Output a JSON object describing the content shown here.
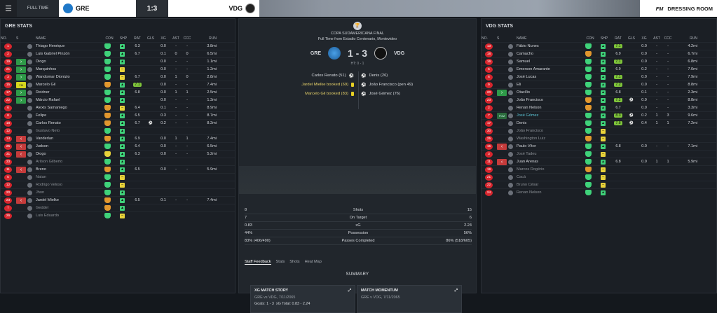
{
  "topbar": {
    "status": "FULL TIME",
    "home": "GRE",
    "score": "1:3",
    "away": "VDG",
    "brand": "FM",
    "section": "DRESSING ROOM"
  },
  "headers": [
    "NO.",
    "S",
    "NAME",
    "CON",
    "SHP",
    "RAT",
    "GLS",
    "XG",
    "AST",
    "CCC",
    "RUN"
  ],
  "colors": {
    "accent_red": "#d8262e",
    "sub_in": "#2e9a48",
    "sub_out": "#c53b3b",
    "best_rating": "#7ec43a"
  },
  "left": {
    "title": "GRE STATS",
    "rows": [
      {
        "no": "1",
        "sub": "",
        "name": "Thiago Henrique",
        "con": "g",
        "shp": "up",
        "rat": "6.3",
        "gls": "",
        "xg": "0.0",
        "ast": "-",
        "ccc": "-",
        "run": "3.8mi"
      },
      {
        "no": "2",
        "sub": "",
        "name": "Luis Gabriel Pinzón",
        "con": "g",
        "shp": "up",
        "rat": "6.7",
        "gls": "",
        "xg": "0.1",
        "ast": "0",
        "ccc": "0",
        "run": "6.5mi"
      },
      {
        "no": "19",
        "sub": "in",
        "name": "Diogo",
        "con": "g",
        "shp": "up",
        "rat": "",
        "gls": "",
        "xg": "0.0",
        "ast": "-",
        "ccc": "-",
        "run": "1.1mi"
      },
      {
        "no": "21",
        "sub": "in",
        "name": "Marquinhos",
        "con": "g",
        "shp": "mid",
        "rat": "",
        "gls": "",
        "xg": "0.0",
        "ast": "-",
        "ccc": "-",
        "run": "1.2mi"
      },
      {
        "no": "3",
        "sub": "in",
        "name": "Wandomar Dionizio",
        "con": "g",
        "shp": "mid",
        "rat": "6.7",
        "gls": "",
        "xg": "0.0",
        "ast": "1",
        "ccc": "0",
        "run": "2.8mi"
      },
      {
        "no": "15",
        "sub": "y",
        "name": "Marcelo Gil",
        "con": "o",
        "shp": "up",
        "rat": "7.1",
        "best": true,
        "gls": "",
        "xg": "0.0",
        "ast": "-",
        "ccc": "-",
        "run": "7.4mi"
      },
      {
        "no": "17",
        "sub": "in",
        "name": "Reidner",
        "con": "g",
        "shp": "up",
        "rat": "6.8",
        "gls": "",
        "xg": "0.0",
        "ast": "1",
        "ccc": "1",
        "run": "2.5mi"
      },
      {
        "no": "22",
        "sub": "in",
        "name": "Márcio Rafael",
        "con": "g",
        "shp": "up",
        "rat": "",
        "gls": "",
        "xg": "0.0",
        "ast": "-",
        "ccc": "-",
        "run": "1.3mi"
      },
      {
        "no": "6",
        "sub": "",
        "name": "Alexis Samaniego",
        "con": "o",
        "shp": "mid",
        "rat": "6.4",
        "gls": "",
        "xg": "0.1",
        "ast": "-",
        "ccc": "-",
        "run": "8.9mi"
      },
      {
        "no": "8",
        "sub": "",
        "name": "Felipe",
        "con": "o",
        "shp": "up",
        "rat": "6.5",
        "gls": "",
        "xg": "0.3",
        "ast": "-",
        "ccc": "-",
        "run": "8.7mi"
      },
      {
        "no": "18",
        "sub": "",
        "name": "Carlos Renato",
        "con": "o",
        "shp": "up",
        "rat": "6.7",
        "gls": "⚽",
        "xg": "0.2",
        "ast": "-",
        "ccc": "-",
        "run": "8.2mi"
      },
      {
        "no": "12",
        "sub": "",
        "name": "Gustavo Neto",
        "con": "g",
        "shp": "up",
        "rat": "",
        "gls": "",
        "xg": "",
        "ast": "",
        "ccc": "",
        "run": "",
        "dim": true
      },
      {
        "no": "14",
        "sub": "out",
        "name": "Vanderlan",
        "con": "o",
        "shp": "up",
        "rat": "6.9",
        "gls": "",
        "xg": "0.0",
        "ast": "1",
        "ccc": "1",
        "run": "7.4mi"
      },
      {
        "no": "25",
        "sub": "out",
        "name": "Judson",
        "con": "g",
        "shp": "up",
        "rat": "6.4",
        "gls": "",
        "xg": "0.0",
        "ast": "-",
        "ccc": "-",
        "run": "6.5mi"
      },
      {
        "no": "31",
        "sub": "out",
        "name": "Diogo",
        "con": "y",
        "shp": "up",
        "rat": "6.3",
        "gls": "",
        "xg": "0.0",
        "ast": "-",
        "ccc": "-",
        "run": "5.2mi"
      },
      {
        "no": "33",
        "sub": "",
        "name": "Arilson Gilberto",
        "con": "g",
        "shp": "up",
        "rat": "",
        "gls": "",
        "xg": "",
        "ast": "",
        "ccc": "",
        "run": "",
        "dim": true
      },
      {
        "no": "11",
        "sub": "out",
        "name": "Breno",
        "con": "o",
        "shp": "up",
        "rat": "6.5",
        "gls": "",
        "xg": "0.0",
        "ast": "-",
        "ccc": "-",
        "run": "5.9mi"
      },
      {
        "no": "5",
        "sub": "",
        "name": "Natan",
        "con": "g",
        "shp": "mid",
        "rat": "",
        "gls": "",
        "xg": "",
        "ast": "",
        "ccc": "",
        "run": "",
        "dim": true
      },
      {
        "no": "12",
        "sub": "",
        "name": "Rodrigo Veloso",
        "con": "g",
        "shp": "mid",
        "rat": "",
        "gls": "",
        "xg": "",
        "ast": "",
        "ccc": "",
        "run": "",
        "dim": true
      },
      {
        "no": "20",
        "sub": "",
        "name": "Jhon",
        "con": "g",
        "shp": "up",
        "rat": "",
        "gls": "",
        "xg": "",
        "ast": "",
        "ccc": "",
        "run": "",
        "dim": true
      },
      {
        "no": "23",
        "sub": "out",
        "name": "Jardel Mielke",
        "con": "o",
        "shp": "up",
        "rat": "6.5",
        "gls": "",
        "xg": "0.1",
        "ast": "-",
        "ccc": "-",
        "run": "7.4mi"
      },
      {
        "no": "7",
        "sub": "",
        "name": "Geddel",
        "con": "o",
        "shp": "up",
        "rat": "",
        "gls": "",
        "xg": "",
        "ast": "",
        "ccc": "",
        "run": "",
        "dim": true
      },
      {
        "no": "26",
        "sub": "",
        "name": "Luis Eduardo",
        "con": "g",
        "shp": "mid",
        "rat": "",
        "gls": "",
        "xg": "",
        "ast": "",
        "ccc": "",
        "run": "",
        "dim": true
      }
    ]
  },
  "right": {
    "title": "VDG STATS",
    "rows": [
      {
        "no": "13",
        "sub": "",
        "name": "Fábio Nunes",
        "con": "g",
        "shp": "up",
        "rat": "7.1",
        "best": true,
        "gls": "",
        "xg": "0.0",
        "ast": "-",
        "ccc": "-",
        "run": "4.2mi"
      },
      {
        "no": "18",
        "sub": "",
        "name": "Camacho",
        "con": "o",
        "shp": "up",
        "rat": "6.9",
        "gls": "",
        "xg": "0.0",
        "ast": "-",
        "ccc": "-",
        "run": "6.7mi"
      },
      {
        "no": "16",
        "sub": "",
        "name": "Samuel",
        "con": "g",
        "shp": "up",
        "rat": "7.1",
        "best": true,
        "gls": "",
        "xg": "0.0",
        "ast": "-",
        "ccc": "-",
        "run": "6.8mi"
      },
      {
        "no": "5",
        "sub": "",
        "name": "Emerson Amarante",
        "con": "g",
        "shp": "up",
        "rat": "6.9",
        "gls": "",
        "xg": "0.2",
        "ast": "-",
        "ccc": "-",
        "run": "7.0mi"
      },
      {
        "no": "6",
        "sub": "",
        "name": "José Lucas",
        "con": "g",
        "shp": "up",
        "rat": "7.1",
        "best": true,
        "gls": "",
        "xg": "0.0",
        "ast": "-",
        "ccc": "-",
        "run": "7.9mi"
      },
      {
        "no": "9",
        "sub": "",
        "name": "Eli",
        "con": "g",
        "shp": "up",
        "rat": "7.2",
        "best": true,
        "gls": "",
        "xg": "0.0",
        "ast": "-",
        "ccc": "-",
        "run": "8.8mi"
      },
      {
        "no": "20",
        "sub": "in",
        "name": "Otacílio",
        "con": "g",
        "shp": "up",
        "rat": "6.8",
        "gls": "",
        "xg": "0.1",
        "ast": "-",
        "ccc": "-",
        "run": "2.3mi"
      },
      {
        "no": "23",
        "sub": "",
        "name": "João Francisco",
        "con": "o",
        "shp": "up",
        "rat": "7.2",
        "best": true,
        "gls": "⚽",
        "xg": "0.9",
        "ast": "-",
        "ccc": "-",
        "run": "8.8mi"
      },
      {
        "no": "2",
        "sub": "",
        "name": "Renan Nelson",
        "con": "o",
        "shp": "up",
        "rat": "6.7",
        "gls": "",
        "xg": "0.0",
        "ast": "-",
        "ccc": "-",
        "run": "3.3mi"
      },
      {
        "no": "7",
        "sub": "pom",
        "name": "José Gómez",
        "hl": true,
        "con": "g",
        "shp": "up",
        "rat": "8.3",
        "best": true,
        "gls": "⚽",
        "xg": "0.2",
        "ast": "1",
        "ccc": "3",
        "run": "9.6mi"
      },
      {
        "no": "17",
        "sub": "",
        "name": "Denis",
        "con": "g",
        "shp": "up",
        "rat": "7.8",
        "best": true,
        "gls": "⚽",
        "xg": "0.4",
        "ast": "1",
        "ccc": "1",
        "run": "7.2mi"
      },
      {
        "no": "30",
        "sub": "",
        "name": "João Francisco",
        "con": "g",
        "shp": "mid",
        "rat": "",
        "gls": "",
        "xg": "",
        "ast": "",
        "ccc": "",
        "run": "",
        "dim": true
      },
      {
        "no": "25",
        "sub": "",
        "name": "Washington Luiz",
        "con": "o",
        "shp": "mid",
        "rat": "",
        "gls": "",
        "xg": "",
        "ast": "",
        "ccc": "",
        "run": "",
        "dim": true
      },
      {
        "no": "15",
        "sub": "out",
        "name": "Paulo Vítor",
        "con": "g",
        "shp": "up",
        "rat": "6.8",
        "gls": "",
        "xg": "0.0",
        "ast": "-",
        "ccc": "-",
        "run": "7.1mi"
      },
      {
        "no": "3",
        "sub": "",
        "name": "José Tadeu",
        "con": "g",
        "shp": "mid",
        "rat": "",
        "gls": "",
        "xg": "",
        "ast": "",
        "ccc": "",
        "run": "",
        "dim": true
      },
      {
        "no": "11",
        "sub": "out",
        "name": "Juan Arenas",
        "con": "g",
        "shp": "up",
        "rat": "6.8",
        "gls": "",
        "xg": "0.0",
        "ast": "1",
        "ccc": "1",
        "run": "5.9mi"
      },
      {
        "no": "19",
        "sub": "",
        "name": "Marcos Rogério",
        "con": "o",
        "shp": "mid",
        "rat": "",
        "gls": "",
        "xg": "",
        "ast": "",
        "ccc": "",
        "run": "",
        "dim": true
      },
      {
        "no": "21",
        "sub": "",
        "name": "Cacá",
        "con": "g",
        "shp": "mid",
        "rat": "",
        "gls": "",
        "xg": "",
        "ast": "",
        "ccc": "",
        "run": "",
        "dim": true
      },
      {
        "no": "22",
        "sub": "",
        "name": "Bruno César",
        "con": "g",
        "shp": "mid",
        "rat": "",
        "gls": "",
        "xg": "",
        "ast": "",
        "ccc": "",
        "run": "",
        "dim": true
      },
      {
        "no": "24",
        "sub": "",
        "name": "Renan Nelson",
        "con": "g",
        "shp": "up",
        "rat": "",
        "gls": "",
        "xg": "",
        "ast": "",
        "ccc": "",
        "run": "",
        "dim": true
      }
    ]
  },
  "match": {
    "competition": "COPA SUDAMERICANA FINAL",
    "venue": "Full Time from Estadio Centenario, Montevideo",
    "home": "GRE",
    "score": "1 - 3",
    "away": "VDG",
    "ht": "HT: 0 - 1",
    "home_events": [
      {
        "text": "Carlos Renato (51)",
        "type": "goal"
      },
      {
        "text": "Jardel Mielke booked (69)",
        "type": "card"
      },
      {
        "text": "Marcelo Gil booked (83)",
        "type": "card"
      }
    ],
    "away_events": [
      {
        "text": "Denis (26)",
        "type": "goal"
      },
      {
        "text": "João Francisco (pen 49)",
        "type": "goal"
      },
      {
        "text": "José Gómez (76)",
        "type": "goal"
      }
    ],
    "stats": [
      {
        "home": "8",
        "label": "Shots",
        "away": "15"
      },
      {
        "home": "7",
        "label": "On Target",
        "away": "6"
      },
      {
        "home": "0.83",
        "label": "xG",
        "away": "2.24"
      },
      {
        "home": "44%",
        "label": "Possession",
        "away": "56%"
      },
      {
        "home": "83% (406/490)",
        "label": "Passes Completed",
        "away": "86% (518/605)"
      }
    ],
    "tabs": [
      "Staff Feedback",
      "Stats",
      "Shots",
      "Heat Map"
    ],
    "summary": "SUMMARY",
    "xg_story": {
      "title": "XG MATCH STORY",
      "sub": "GRE vs VDG, 7/11/2065",
      "goals": "Goals: 1 - 3",
      "xg": "xG Total: 0.83 - 2.24"
    },
    "momentum": {
      "title": "MATCH MOMENTUM",
      "sub": "GRE v VDG, 7/11/2065"
    }
  }
}
